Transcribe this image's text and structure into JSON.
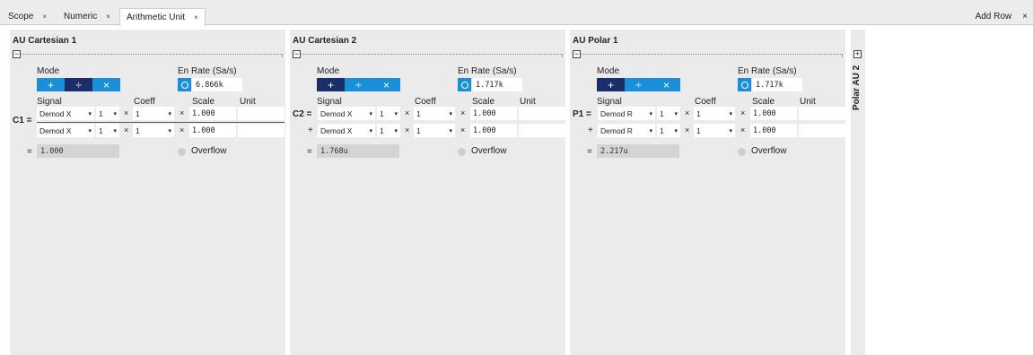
{
  "tabs": [
    {
      "label": "Scope",
      "close": "×"
    },
    {
      "label": "Numeric",
      "close": "×"
    },
    {
      "label": "Arithmetic Unit",
      "close": "×"
    }
  ],
  "toolbar": {
    "add_row": "Add Row",
    "close": "×"
  },
  "labels": {
    "mode": "Mode",
    "en": "En",
    "rate": "Rate (Sa/s)",
    "signal": "Signal",
    "coeff": "Coeff",
    "scale": "Scale",
    "unit": "Unit",
    "overflow": "Overflow",
    "equals": "=",
    "plus": "+",
    "times": "×",
    "caret": "▾"
  },
  "mode_buttons": [
    "+",
    "÷",
    "×"
  ],
  "colors": {
    "accent": "#1a8fd8",
    "selected": "#1a2e6c",
    "panel_bg": "#ebebeb",
    "result_bg": "#d4d4d4"
  },
  "panels": [
    {
      "title": "AU Cartesian 1",
      "collapse": "−",
      "selected_mode": "÷",
      "rate": "6.866k",
      "row_label": "C1 =",
      "rows": [
        {
          "signal": "Demod X",
          "ch": "1",
          "coeff": "1",
          "scale": "1.000",
          "unit": ""
        },
        {
          "signal": "Demod X",
          "ch": "1",
          "coeff": "1",
          "scale": "1.000",
          "unit": ""
        }
      ],
      "result": "1.000"
    },
    {
      "title": "AU Cartesian 2",
      "collapse": "−",
      "selected_mode": "+",
      "rate": "1.717k",
      "row_label": "C2 =",
      "rows": [
        {
          "signal": "Demod X",
          "ch": "1",
          "coeff": "1",
          "scale": "1.000",
          "unit": ""
        },
        {
          "signal": "Demod X",
          "ch": "1",
          "coeff": "1",
          "scale": "1.000",
          "unit": ""
        }
      ],
      "result": "1.768u"
    },
    {
      "title": "AU Polar 1",
      "collapse": "−",
      "selected_mode": "+",
      "rate": "1.717k",
      "row_label": "P1 =",
      "rows": [
        {
          "signal": "Demod R",
          "ch": "1",
          "coeff": "1",
          "scale": "1.000",
          "unit": ""
        },
        {
          "signal": "Demod R",
          "ch": "1",
          "coeff": "1",
          "scale": "1.000",
          "unit": ""
        }
      ],
      "result": "2.217u"
    }
  ],
  "side_panel": {
    "title": "Polar AU 2",
    "expand": "+"
  }
}
